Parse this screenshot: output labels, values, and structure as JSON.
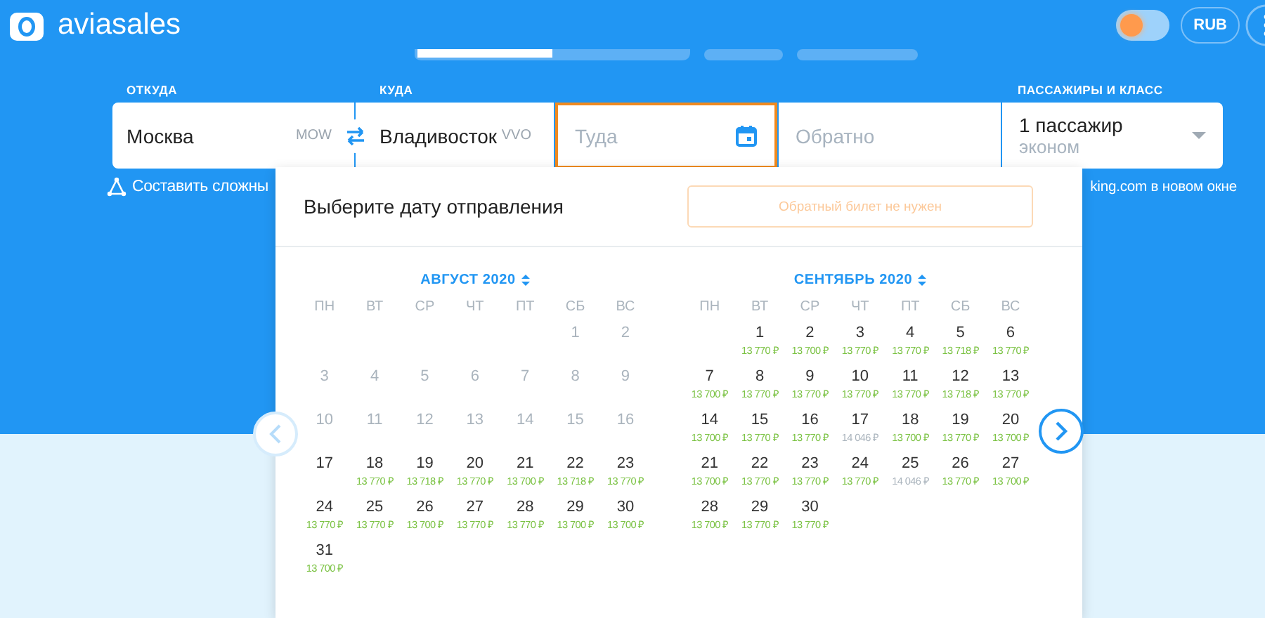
{
  "brand": {
    "name": "aviasales"
  },
  "top_actions": {
    "theme_toggle_on": false,
    "currency": "RUB"
  },
  "search": {
    "fields": [
      {
        "kind": "city",
        "label": "ОТКУДА",
        "value": "Москва",
        "code": "MOW"
      },
      {
        "kind": "city",
        "label": "КУДА",
        "value": "Владивосток",
        "code": "VVO"
      },
      {
        "kind": "date",
        "placeholder": "Туда",
        "focused": true
      },
      {
        "kind": "date",
        "placeholder": "Обратно",
        "focused": false
      },
      {
        "kind": "passengers",
        "label": "ПАССАЖИРЫ И КЛАСС",
        "value": "1 пассажир",
        "sub": "эконом"
      }
    ]
  },
  "links": {
    "left": "Составить сложны",
    "right": "king.com в новом окне"
  },
  "datepicker": {
    "title": "Выберите дату отправления",
    "no_return_button": "Обратный билет не нужен",
    "prev_disabled": true,
    "months": [
      {
        "title": "АВГУСТ 2020",
        "weekdays": [
          "ПН",
          "ВТ",
          "СР",
          "ЧТ",
          "ПТ",
          "СБ",
          "ВС"
        ],
        "weeks": [
          [
            {
              "kind": "empty"
            },
            {
              "kind": "empty"
            },
            {
              "kind": "empty"
            },
            {
              "kind": "empty"
            },
            {
              "kind": "empty"
            },
            {
              "day": "1",
              "past": true
            },
            {
              "day": "2",
              "past": true
            }
          ],
          [
            {
              "day": "3",
              "past": true
            },
            {
              "day": "4",
              "past": true
            },
            {
              "day": "5",
              "past": true
            },
            {
              "day": "6",
              "past": true
            },
            {
              "day": "7",
              "past": true
            },
            {
              "day": "8",
              "past": true
            },
            {
              "day": "9",
              "past": true
            }
          ],
          [
            {
              "day": "10",
              "past": true
            },
            {
              "day": "11",
              "past": true
            },
            {
              "day": "12",
              "past": true
            },
            {
              "day": "13",
              "past": true
            },
            {
              "day": "14",
              "past": true
            },
            {
              "day": "15",
              "past": true
            },
            {
              "day": "16",
              "past": true
            }
          ],
          [
            {
              "day": "17",
              "past": false
            },
            {
              "day": "18",
              "past": false,
              "price": "13 770 ₽",
              "high": false
            },
            {
              "day": "19",
              "past": false,
              "price": "13 718 ₽",
              "high": false
            },
            {
              "day": "20",
              "past": false,
              "price": "13 770 ₽",
              "high": false
            },
            {
              "day": "21",
              "past": false,
              "price": "13 700 ₽",
              "high": false
            },
            {
              "day": "22",
              "past": false,
              "price": "13 718 ₽",
              "high": false
            },
            {
              "day": "23",
              "past": false,
              "price": "13 770 ₽",
              "high": false
            }
          ],
          [
            {
              "day": "24",
              "past": false,
              "price": "13 770 ₽",
              "high": false
            },
            {
              "day": "25",
              "past": false,
              "price": "13 770 ₽",
              "high": false
            },
            {
              "day": "26",
              "past": false,
              "price": "13 700 ₽",
              "high": false
            },
            {
              "day": "27",
              "past": false,
              "price": "13 770 ₽",
              "high": false
            },
            {
              "day": "28",
              "past": false,
              "price": "13 770 ₽",
              "high": false
            },
            {
              "day": "29",
              "past": false,
              "price": "13 700 ₽",
              "high": false
            },
            {
              "day": "30",
              "past": false,
              "price": "13 700 ₽",
              "high": false
            }
          ],
          [
            {
              "day": "31",
              "past": false,
              "price": "13 700 ₽",
              "high": false
            }
          ]
        ]
      },
      {
        "title": "СЕНТЯБРЬ 2020",
        "weekdays": [
          "ПН",
          "ВТ",
          "СР",
          "ЧТ",
          "ПТ",
          "СБ",
          "ВС"
        ],
        "weeks": [
          [
            {
              "kind": "empty"
            },
            {
              "day": "1",
              "past": false,
              "price": "13 770 ₽",
              "high": false
            },
            {
              "day": "2",
              "past": false,
              "price": "13 700 ₽",
              "high": false
            },
            {
              "day": "3",
              "past": false,
              "price": "13 770 ₽",
              "high": false
            },
            {
              "day": "4",
              "past": false,
              "price": "13 770 ₽",
              "high": false
            },
            {
              "day": "5",
              "past": false,
              "price": "13 718 ₽",
              "high": false
            },
            {
              "day": "6",
              "past": false,
              "price": "13 770 ₽",
              "high": false
            }
          ],
          [
            {
              "day": "7",
              "past": false,
              "price": "13 700 ₽",
              "high": false
            },
            {
              "day": "8",
              "past": false,
              "price": "13 770 ₽",
              "high": false
            },
            {
              "day": "9",
              "past": false,
              "price": "13 770 ₽",
              "high": false
            },
            {
              "day": "10",
              "past": false,
              "price": "13 770 ₽",
              "high": false
            },
            {
              "day": "11",
              "past": false,
              "price": "13 770 ₽",
              "high": false
            },
            {
              "day": "12",
              "past": false,
              "price": "13 718 ₽",
              "high": false
            },
            {
              "day": "13",
              "past": false,
              "price": "13 770 ₽",
              "high": false
            }
          ],
          [
            {
              "day": "14",
              "past": false,
              "price": "13 700 ₽",
              "high": false
            },
            {
              "day": "15",
              "past": false,
              "price": "13 770 ₽",
              "high": false
            },
            {
              "day": "16",
              "past": false,
              "price": "13 770 ₽",
              "high": false
            },
            {
              "day": "17",
              "past": false,
              "price": "14 046 ₽",
              "high": true
            },
            {
              "day": "18",
              "past": false,
              "price": "13 700 ₽",
              "high": false
            },
            {
              "day": "19",
              "past": false,
              "price": "13 770 ₽",
              "high": false
            },
            {
              "day": "20",
              "past": false,
              "price": "13 700 ₽",
              "high": false
            }
          ],
          [
            {
              "day": "21",
              "past": false,
              "price": "13 700 ₽",
              "high": false
            },
            {
              "day": "22",
              "past": false,
              "price": "13 770 ₽",
              "high": false
            },
            {
              "day": "23",
              "past": false,
              "price": "13 770 ₽",
              "high": false
            },
            {
              "day": "24",
              "past": false,
              "price": "13 770 ₽",
              "high": false
            },
            {
              "day": "25",
              "past": false,
              "price": "14 046 ₽",
              "high": true
            },
            {
              "day": "26",
              "past": false,
              "price": "13 770 ₽",
              "high": false
            },
            {
              "day": "27",
              "past": false,
              "price": "13 700 ₽",
              "high": false
            }
          ],
          [
            {
              "day": "28",
              "past": false,
              "price": "13 700 ₽",
              "high": false
            },
            {
              "day": "29",
              "past": false,
              "price": "13 770 ₽",
              "high": false
            },
            {
              "day": "30",
              "past": false,
              "price": "13 770 ₽",
              "high": false
            }
          ]
        ]
      }
    ]
  }
}
